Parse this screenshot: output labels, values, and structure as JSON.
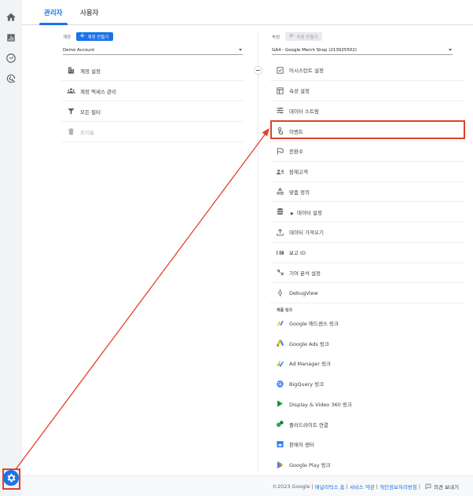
{
  "tabs": [
    {
      "label": "관리자",
      "active": true
    },
    {
      "label": "사용자",
      "active": false
    }
  ],
  "account": {
    "label": "계정",
    "create_button": "계정 만들기",
    "selected": "Demo Account",
    "items": [
      {
        "label": "계정 설정",
        "icon": "building-icon"
      },
      {
        "label": "계정 액세스 관리",
        "icon": "people-icon"
      },
      {
        "label": "모든 필터",
        "icon": "filter-icon"
      },
      {
        "label": "휴지통",
        "icon": "trash-icon",
        "disabled": true
      }
    ]
  },
  "property": {
    "label": "속성",
    "create_button": "속성 만들기",
    "selected": "GA4 - Google Merch Shop (213025502)",
    "items": [
      {
        "label": "어시스턴트 설정",
        "icon": "checkbox-icon"
      },
      {
        "label": "속성 설정",
        "icon": "window-icon"
      },
      {
        "label": "데이터 스트림",
        "icon": "streams-icon"
      },
      {
        "label": "이벤트",
        "icon": "touch-icon",
        "highlighted": true
      },
      {
        "label": "전환수",
        "icon": "flag-icon"
      },
      {
        "label": "잠재고객",
        "icon": "audience-icon"
      },
      {
        "label": "맞춤 정의",
        "icon": "shapes-icon"
      },
      {
        "label": "데이터 설정",
        "icon": "database-icon",
        "expandable": true
      },
      {
        "label": "데이터 가져오기",
        "icon": "upload-icon"
      },
      {
        "label": "보고 ID",
        "icon": "report-id-icon"
      },
      {
        "label": "기여 분석 설정",
        "icon": "attribution-icon"
      },
      {
        "label": "DebugView",
        "icon": "debug-icon"
      }
    ],
    "product_links_header": "제품 링크",
    "product_links": [
      {
        "label": "Google 애드센스 링크",
        "icon": "adsense-icon"
      },
      {
        "label": "Google Ads 링크",
        "icon": "google-ads-icon"
      },
      {
        "label": "Ad Manager 링크",
        "icon": "ad-manager-icon"
      },
      {
        "label": "BigQuery 링크",
        "icon": "bigquery-icon"
      },
      {
        "label": "Display & Video 360 링크",
        "icon": "dv360-icon"
      },
      {
        "label": "플러드라이트 연결",
        "icon": "floodlight-icon"
      },
      {
        "label": "판매자 센터",
        "icon": "merchant-center-icon"
      },
      {
        "label": "Google Play 링크",
        "icon": "google-play-icon"
      }
    ]
  },
  "footer": {
    "copyright": "©2023 Google",
    "links": [
      "애널리틱스 홈",
      "서비스 약관",
      "개인정보처리방침"
    ],
    "feedback": "의견 보내기"
  },
  "colors": {
    "accent": "#1a73e8",
    "annotation": "#e0402b"
  }
}
